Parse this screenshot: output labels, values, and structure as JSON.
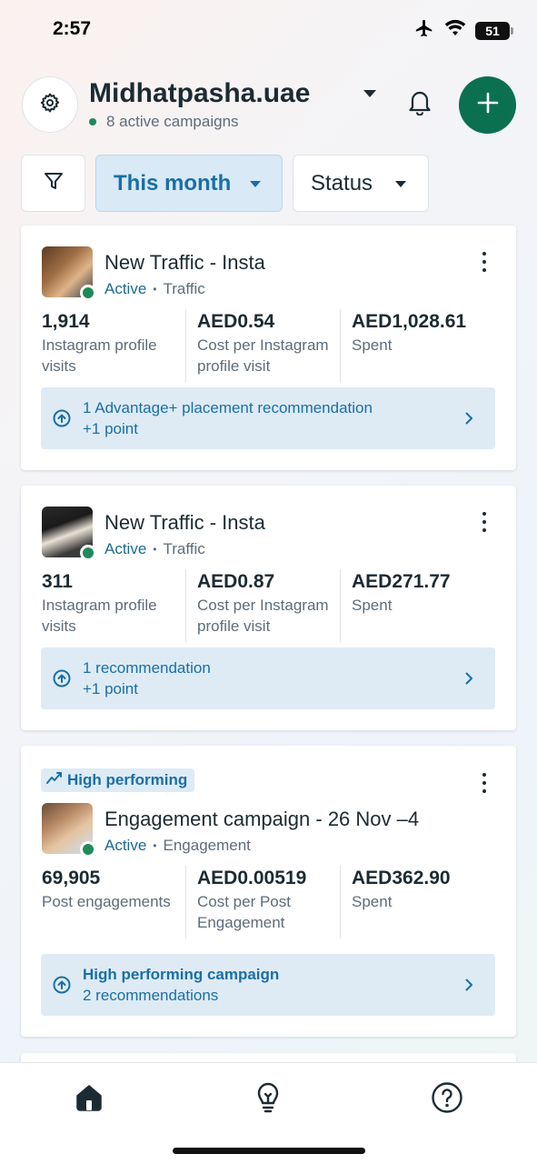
{
  "status_bar": {
    "time": "2:57",
    "battery": "51"
  },
  "header": {
    "account_name": "Midhatpasha.uae",
    "subtitle": "8 active campaigns"
  },
  "filters": {
    "date_chip": "This month",
    "status_chip": "Status"
  },
  "campaigns": [
    {
      "title": "New Traffic - Insta",
      "status": "Active",
      "objective": "Traffic",
      "metrics": [
        {
          "value": "1,914",
          "label": "Instagram profile visits"
        },
        {
          "value": "AED0.54",
          "label": "Cost per Instagram profile visit"
        },
        {
          "value": "AED1,028.61",
          "label": "Spent"
        }
      ],
      "recommendation": {
        "line1": "1 Advantage+ placement recommendation",
        "line2": "+1 point"
      }
    },
    {
      "title": "New Traffic - Insta",
      "status": "Active",
      "objective": "Traffic",
      "metrics": [
        {
          "value": "311",
          "label": "Instagram profile visits"
        },
        {
          "value": "AED0.87",
          "label": "Cost per Instagram profile visit"
        },
        {
          "value": "AED271.77",
          "label": "Spent"
        }
      ],
      "recommendation": {
        "line1": "1 recommendation",
        "line2": "+1 point"
      }
    },
    {
      "badge": "High performing",
      "title": "Engagement campaign - 26 Nov –4",
      "status": "Active",
      "objective": "Engagement",
      "metrics": [
        {
          "value": "69,905",
          "label": "Post engagements"
        },
        {
          "value": "AED0.00519",
          "label": "Cost per Post Engagement"
        },
        {
          "value": "AED362.90",
          "label": "Spent"
        }
      ],
      "recommendation": {
        "line1": "High performing campaign",
        "line2": "2 recommendations"
      }
    }
  ],
  "bottom_nav": {
    "items": [
      {
        "icon": "home-icon"
      },
      {
        "icon": "lightbulb-icon"
      },
      {
        "icon": "help-icon"
      }
    ]
  },
  "colors": {
    "accent_green": "#0a7050",
    "link_blue": "#1a6fa6",
    "chip_bg": "#d9e9f6",
    "rec_bg": "#deebf5"
  }
}
